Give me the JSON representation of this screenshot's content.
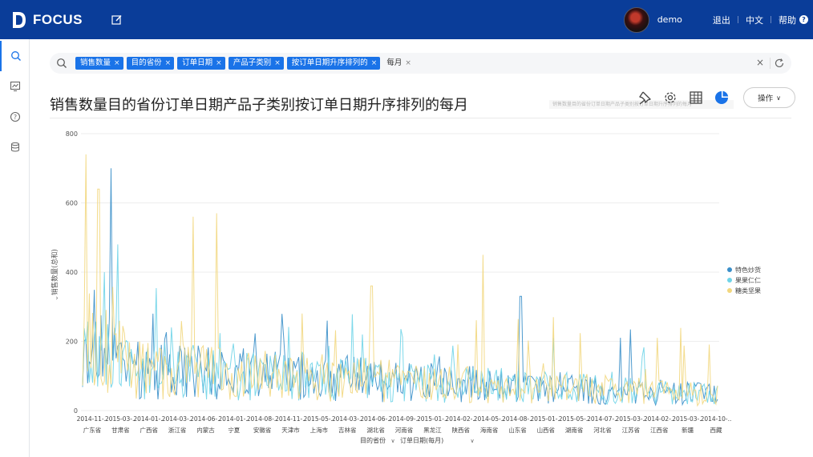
{
  "app": {
    "brand": "FOCUS"
  },
  "topbar": {
    "user": "demo",
    "logout": "退出",
    "language": "中文",
    "help": "帮助"
  },
  "search": {
    "tags": [
      {
        "label": "销售数量",
        "style": "token"
      },
      {
        "label": "目的省份",
        "style": "token"
      },
      {
        "label": "订单日期",
        "style": "token"
      },
      {
        "label": "产品子类别",
        "style": "token"
      },
      {
        "label": "按订单日期升序排列的",
        "style": "token"
      },
      {
        "label": "每月",
        "style": "plain"
      }
    ]
  },
  "page": {
    "title": "销售数量目的省份订单日期产品子类别按订单日期升序排列的每月",
    "operate_label": "操作",
    "hint_text": "销售数量目的省份订单日期产品子类别按订单日期升序排列的每月"
  },
  "chart_data": {
    "type": "line",
    "ylabel": "销售数量(总和)",
    "ylim": [
      0,
      800
    ],
    "yticks": [
      0,
      200,
      400,
      600,
      800
    ],
    "xlabel_parts": [
      "目的省份",
      "订单日期(每月)"
    ],
    "x_date_ticks": [
      "2014-11-..",
      "2015-03-..",
      "2014-01-..",
      "2014-03-..",
      "2014-06-..",
      "2014-01-..",
      "2014-08-..",
      "2014-11-..",
      "2015-05-..",
      "2014-03-..",
      "2014-06-..",
      "2014-09-..",
      "2015-01-..",
      "2014-02-..",
      "2014-05-..",
      "2014-08-..",
      "2015-01-..",
      "2015-05-..",
      "2014-07-..",
      "2015-03-..",
      "2014-02-..",
      "2015-03-..",
      "2014-10-.."
    ],
    "x_province_ticks": [
      "广东省",
      "甘肃省",
      "广西省",
      "浙江省",
      "内蒙古",
      "宁夏",
      "安徽省",
      "天津市",
      "上海市",
      "吉林省",
      "湖北省",
      "河南省",
      "黑龙江",
      "陕西省",
      "海南省",
      "山东省",
      "山西省",
      "湖南省",
      "河北省",
      "江苏省",
      "江西省",
      "新疆",
      "西藏"
    ],
    "legend_position": "right",
    "series": [
      {
        "name": "特色炒货",
        "color": "#3a8fc9",
        "peaks": [
          [
            0.045,
            700
          ],
          [
            0.69,
            330
          ],
          [
            0.11,
            280
          ],
          [
            0.385,
            260
          ]
        ]
      },
      {
        "name": "果果仁仁",
        "color": "#6fd4e8",
        "peaks": [
          [
            0.055,
            480
          ],
          [
            0.035,
            400
          ],
          [
            0.14,
            240
          ],
          [
            0.44,
            220
          ]
        ]
      },
      {
        "name": "糖类坚果",
        "color": "#f2d77e",
        "peaks": [
          [
            0.005,
            740
          ],
          [
            0.025,
            640
          ],
          [
            0.175,
            560
          ],
          [
            0.21,
            570
          ],
          [
            0.63,
            450
          ],
          [
            0.455,
            360
          ],
          [
            0.905,
            210
          ]
        ]
      }
    ],
    "grid": true
  }
}
